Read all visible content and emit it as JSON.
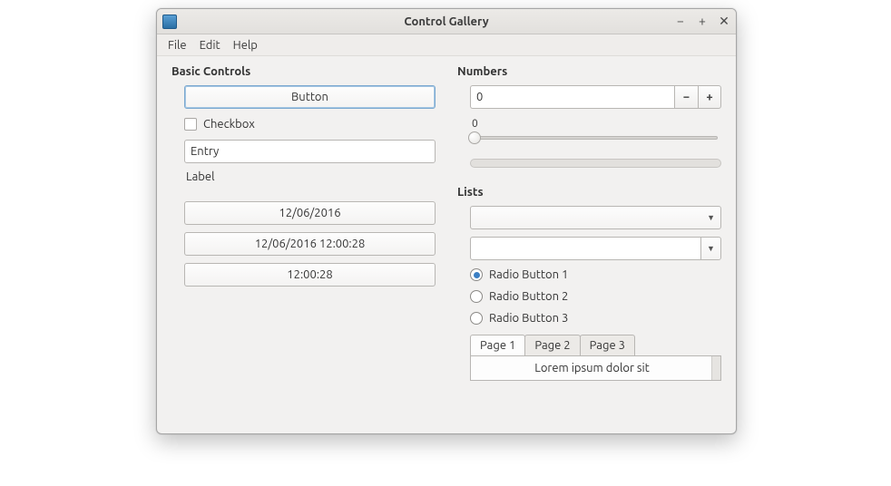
{
  "window": {
    "title": "Control Gallery"
  },
  "menu": {
    "file": "File",
    "edit": "Edit",
    "help": "Help"
  },
  "basic": {
    "title": "Basic Controls",
    "button_label": "Button",
    "checkbox_label": "Checkbox",
    "entry_value": "Entry",
    "label_text": "Label",
    "date_value": "12/06/2016",
    "datetime_value": "12/06/2016 12:00:28",
    "time_value": "12:00:28"
  },
  "numbers": {
    "title": "Numbers",
    "spin_value": "0",
    "slider_value": "0"
  },
  "lists": {
    "title": "Lists",
    "radio1": "Radio Button 1",
    "radio2": "Radio Button 2",
    "radio3": "Radio Button 3",
    "tab1": "Page 1",
    "tab2": "Page 2",
    "tab3": "Page 3",
    "lorem": "Lorem ipsum dolor sit"
  }
}
